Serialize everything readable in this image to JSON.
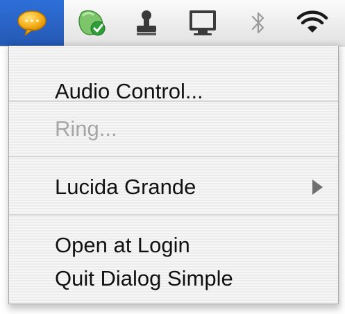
{
  "menubar": {
    "items": [
      {
        "icon": "speech-bubble-icon",
        "selected": true
      },
      {
        "icon": "green-check-status-icon",
        "selected": false
      },
      {
        "icon": "stamp-icon",
        "selected": false
      },
      {
        "icon": "display-icon",
        "selected": false
      },
      {
        "icon": "bluetooth-icon",
        "selected": false
      },
      {
        "icon": "wifi-icon",
        "selected": false
      }
    ],
    "selected_color": "#2a64c6"
  },
  "menu": {
    "items": [
      {
        "label": "Audio Control...",
        "enabled": true
      },
      {
        "label": "Ring...",
        "enabled": false
      },
      {
        "label": "Lucida Grande",
        "enabled": true,
        "submenu": true
      },
      {
        "label": "Open at Login",
        "enabled": true
      },
      {
        "label": "Quit Dialog Simple",
        "enabled": true
      }
    ]
  }
}
